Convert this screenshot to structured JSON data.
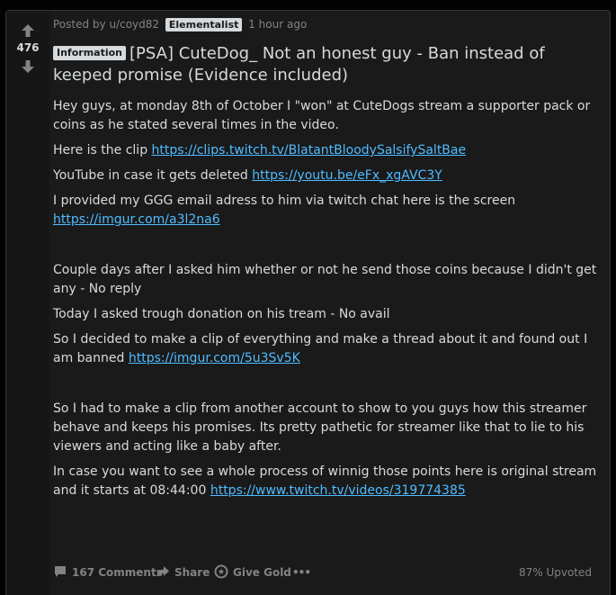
{
  "post": {
    "score": "476",
    "posted_by": "Posted by u/coyd82",
    "user_flair": "Elementalist",
    "time_ago": "1 hour ago",
    "post_flair": "Information",
    "title": "[PSA] CuteDog_ Not an honest guy - Ban instead of keeped promise (Evidence included)",
    "paragraphs": {
      "p1": "Hey guys, at monday 8th of October I \"won\" at CuteDogs stream a supporter pack or coins as he stated several times in the video.",
      "p2_text": "Here is the clip ",
      "p2_link": "https://clips.twitch.tv/BlatantBloodySalsifySaltBae",
      "p3_text": "YouTube in case it gets deleted ",
      "p3_link": "https://youtu.be/eFx_xgAVC3Y",
      "p4_text": "I provided my GGG email adress to him via twitch chat here is the screen ",
      "p4_link": "https://imgur.com/a3l2na6",
      "p5": "Couple days after I asked him whether or not he send those coins because I didn't get any - No reply",
      "p6": "Today I asked trough donation on his tream - No avail",
      "p7_text": "So I decided to make a clip of everything and make a thread about it and found out I am banned ",
      "p7_link": "https://imgur.com/5u3Sv5K",
      "p8": "So I had to make a clip from another account to show to you guys how this streamer behave and keeps his promises. Its pretty pathetic for streamer like that to lie to his viewers and acting like a baby after.",
      "p9_text": "In case you want to see a whole process of winnig those points here is original stream and it starts at 08:44:00 ",
      "p9_link": "https://www.twitch.tv/videos/319774385"
    },
    "actions": {
      "comments": "167 Comments",
      "share": "Share",
      "give_gold": "Give Gold",
      "more": "•••",
      "upvoted": "87% Upvoted"
    }
  },
  "colors": {
    "background": "#030303",
    "card": "#1a1a1b",
    "text": "#d7dadc",
    "muted": "#818384",
    "link": "#4fbcff"
  },
  "icons": [
    "upvote-arrow-icon",
    "downvote-arrow-icon",
    "comment-icon",
    "share-icon",
    "gold-icon",
    "more-icon"
  ]
}
